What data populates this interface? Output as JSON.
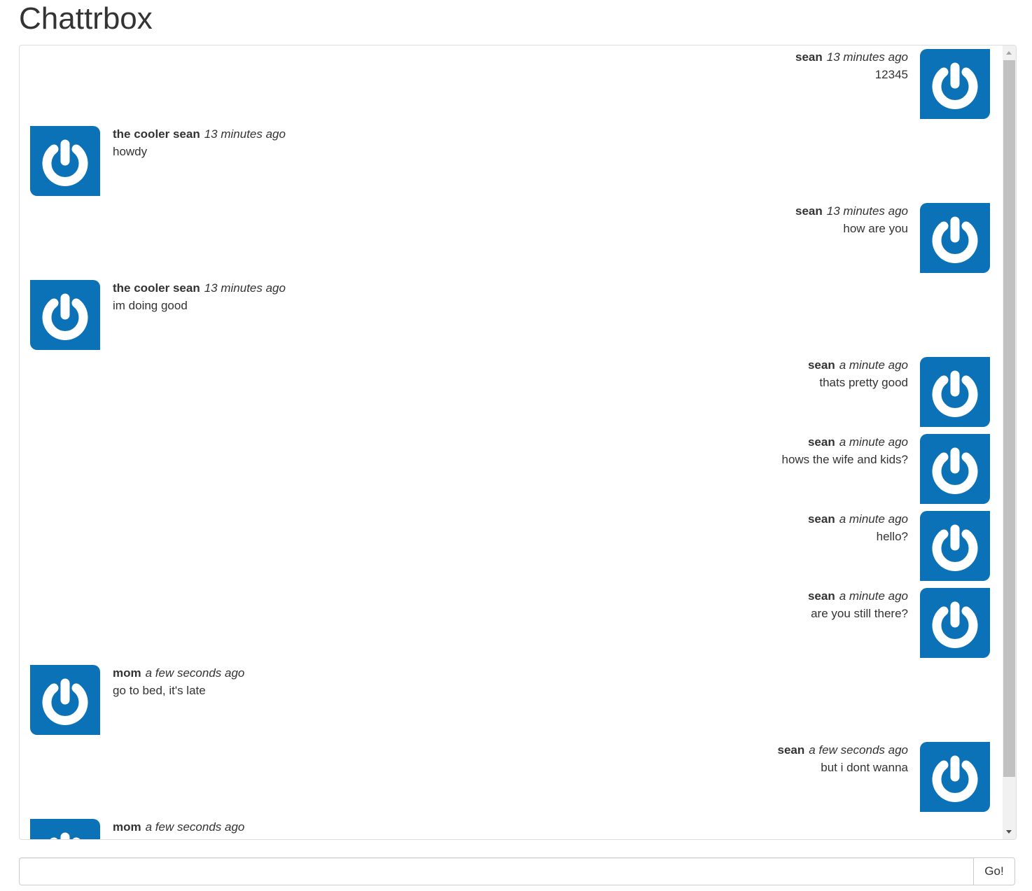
{
  "app": {
    "title": "Chattrbox"
  },
  "messages": [
    {
      "user": "sean",
      "time": "13 minutes ago",
      "text": "12345",
      "side": "right"
    },
    {
      "user": "the cooler sean",
      "time": "13 minutes ago",
      "text": "howdy",
      "side": "left"
    },
    {
      "user": "sean",
      "time": "13 minutes ago",
      "text": "how are you",
      "side": "right"
    },
    {
      "user": "the cooler sean",
      "time": "13 minutes ago",
      "text": "im doing good",
      "side": "left"
    },
    {
      "user": "sean",
      "time": "a minute ago",
      "text": "thats pretty good",
      "side": "right"
    },
    {
      "user": "sean",
      "time": "a minute ago",
      "text": "hows the wife and kids?",
      "side": "right"
    },
    {
      "user": "sean",
      "time": "a minute ago",
      "text": "hello?",
      "side": "right"
    },
    {
      "user": "sean",
      "time": "a minute ago",
      "text": "are you still there?",
      "side": "right"
    },
    {
      "user": "mom",
      "time": "a few seconds ago",
      "text": "go to bed, it's late",
      "side": "left"
    },
    {
      "user": "sean",
      "time": "a few seconds ago",
      "text": "but i dont wanna",
      "side": "right"
    },
    {
      "user": "mom",
      "time": "a few seconds ago",
      "text": "",
      "side": "left"
    }
  ],
  "avatar": {
    "icon": "power-icon",
    "background_color": "#0b72b8"
  },
  "composer": {
    "input_value": "",
    "send_label": "Go!"
  }
}
